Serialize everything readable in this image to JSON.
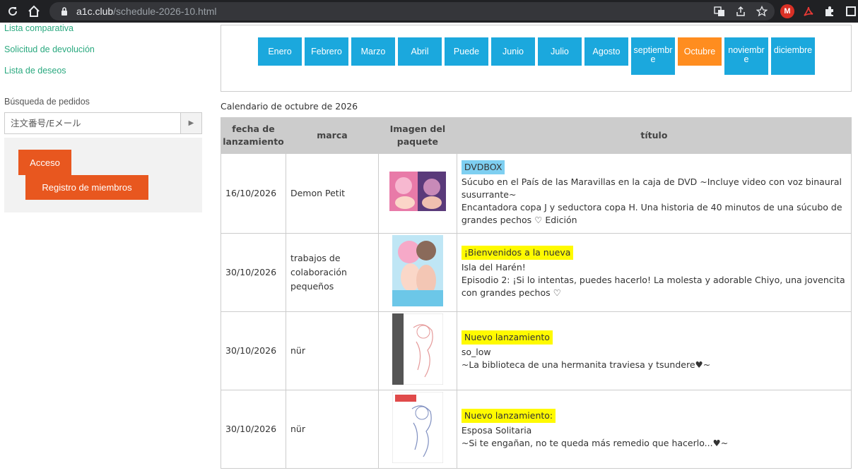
{
  "browser": {
    "url_host": "a1c.club",
    "url_path": "/schedule-2026-10.html"
  },
  "sidebar": {
    "links": [
      "Lista comparativa",
      "Solicitud de devolución",
      "Lista de deseos"
    ],
    "order_search_label": "Búsqueda de pedidos",
    "order_search_placeholder": "注文番号/Eメール",
    "login_button": "Acceso",
    "register_button": "Registro de miembros"
  },
  "months": {
    "items": [
      "Enero",
      "Febrero",
      "Marzo",
      "Abril",
      "Puede",
      "Junio",
      "Julio",
      "Agosto",
      "septiembre",
      "Octubre",
      "noviembre",
      "diciembre"
    ],
    "active": "Octubre"
  },
  "calendar": {
    "caption": "Calendario de octubre de 2026",
    "headers": {
      "date": "fecha de lanzamiento",
      "brand": "marca",
      "image": "Imagen del paquete",
      "title": "título"
    },
    "rows": [
      {
        "date": "16/10/2026",
        "brand": "Demon Petit",
        "badge": "DVDBOX",
        "title_lines": [
          "Súcubo en el País de las Maravillas en la caja de DVD ~Incluye video con voz binaural susurrante~",
          "Encantadora copa J y seductora copa H. Una historia de 40 minutos de una súcubo de grandes pechos ♡ Edición"
        ]
      },
      {
        "date": "30/10/2026",
        "brand": "trabajos de colaboración pequeños",
        "badge": "¡Bienvenidos a la nueva",
        "title_lines": [
          "Isla del Harén!",
          "Episodio 2: ¡Si lo intentas, puedes hacerlo! La molesta y adorable Chiyo, una jovencita con grandes pechos ♡"
        ]
      },
      {
        "date": "30/10/2026",
        "brand": "nür",
        "badge": "Nuevo lanzamiento",
        "title_lines": [
          "so_low",
          "~La biblioteca de una hermanita traviesa y tsundere♥~"
        ]
      },
      {
        "date": "30/10/2026",
        "brand": "nür",
        "badge": "Nuevo lanzamiento:",
        "title_lines": [
          "Esposa Solitaria",
          "~Si te engañan, no te queda más remedio que hacerlo...♥~"
        ]
      }
    ]
  },
  "colors": {
    "month_blue": "#1ba8dd",
    "month_active": "#ff8d1f",
    "button_orange": "#e8571f",
    "link_green": "#2aa97f",
    "badge_blue": "#7ecff1",
    "badge_yellow": "#fffa00"
  }
}
